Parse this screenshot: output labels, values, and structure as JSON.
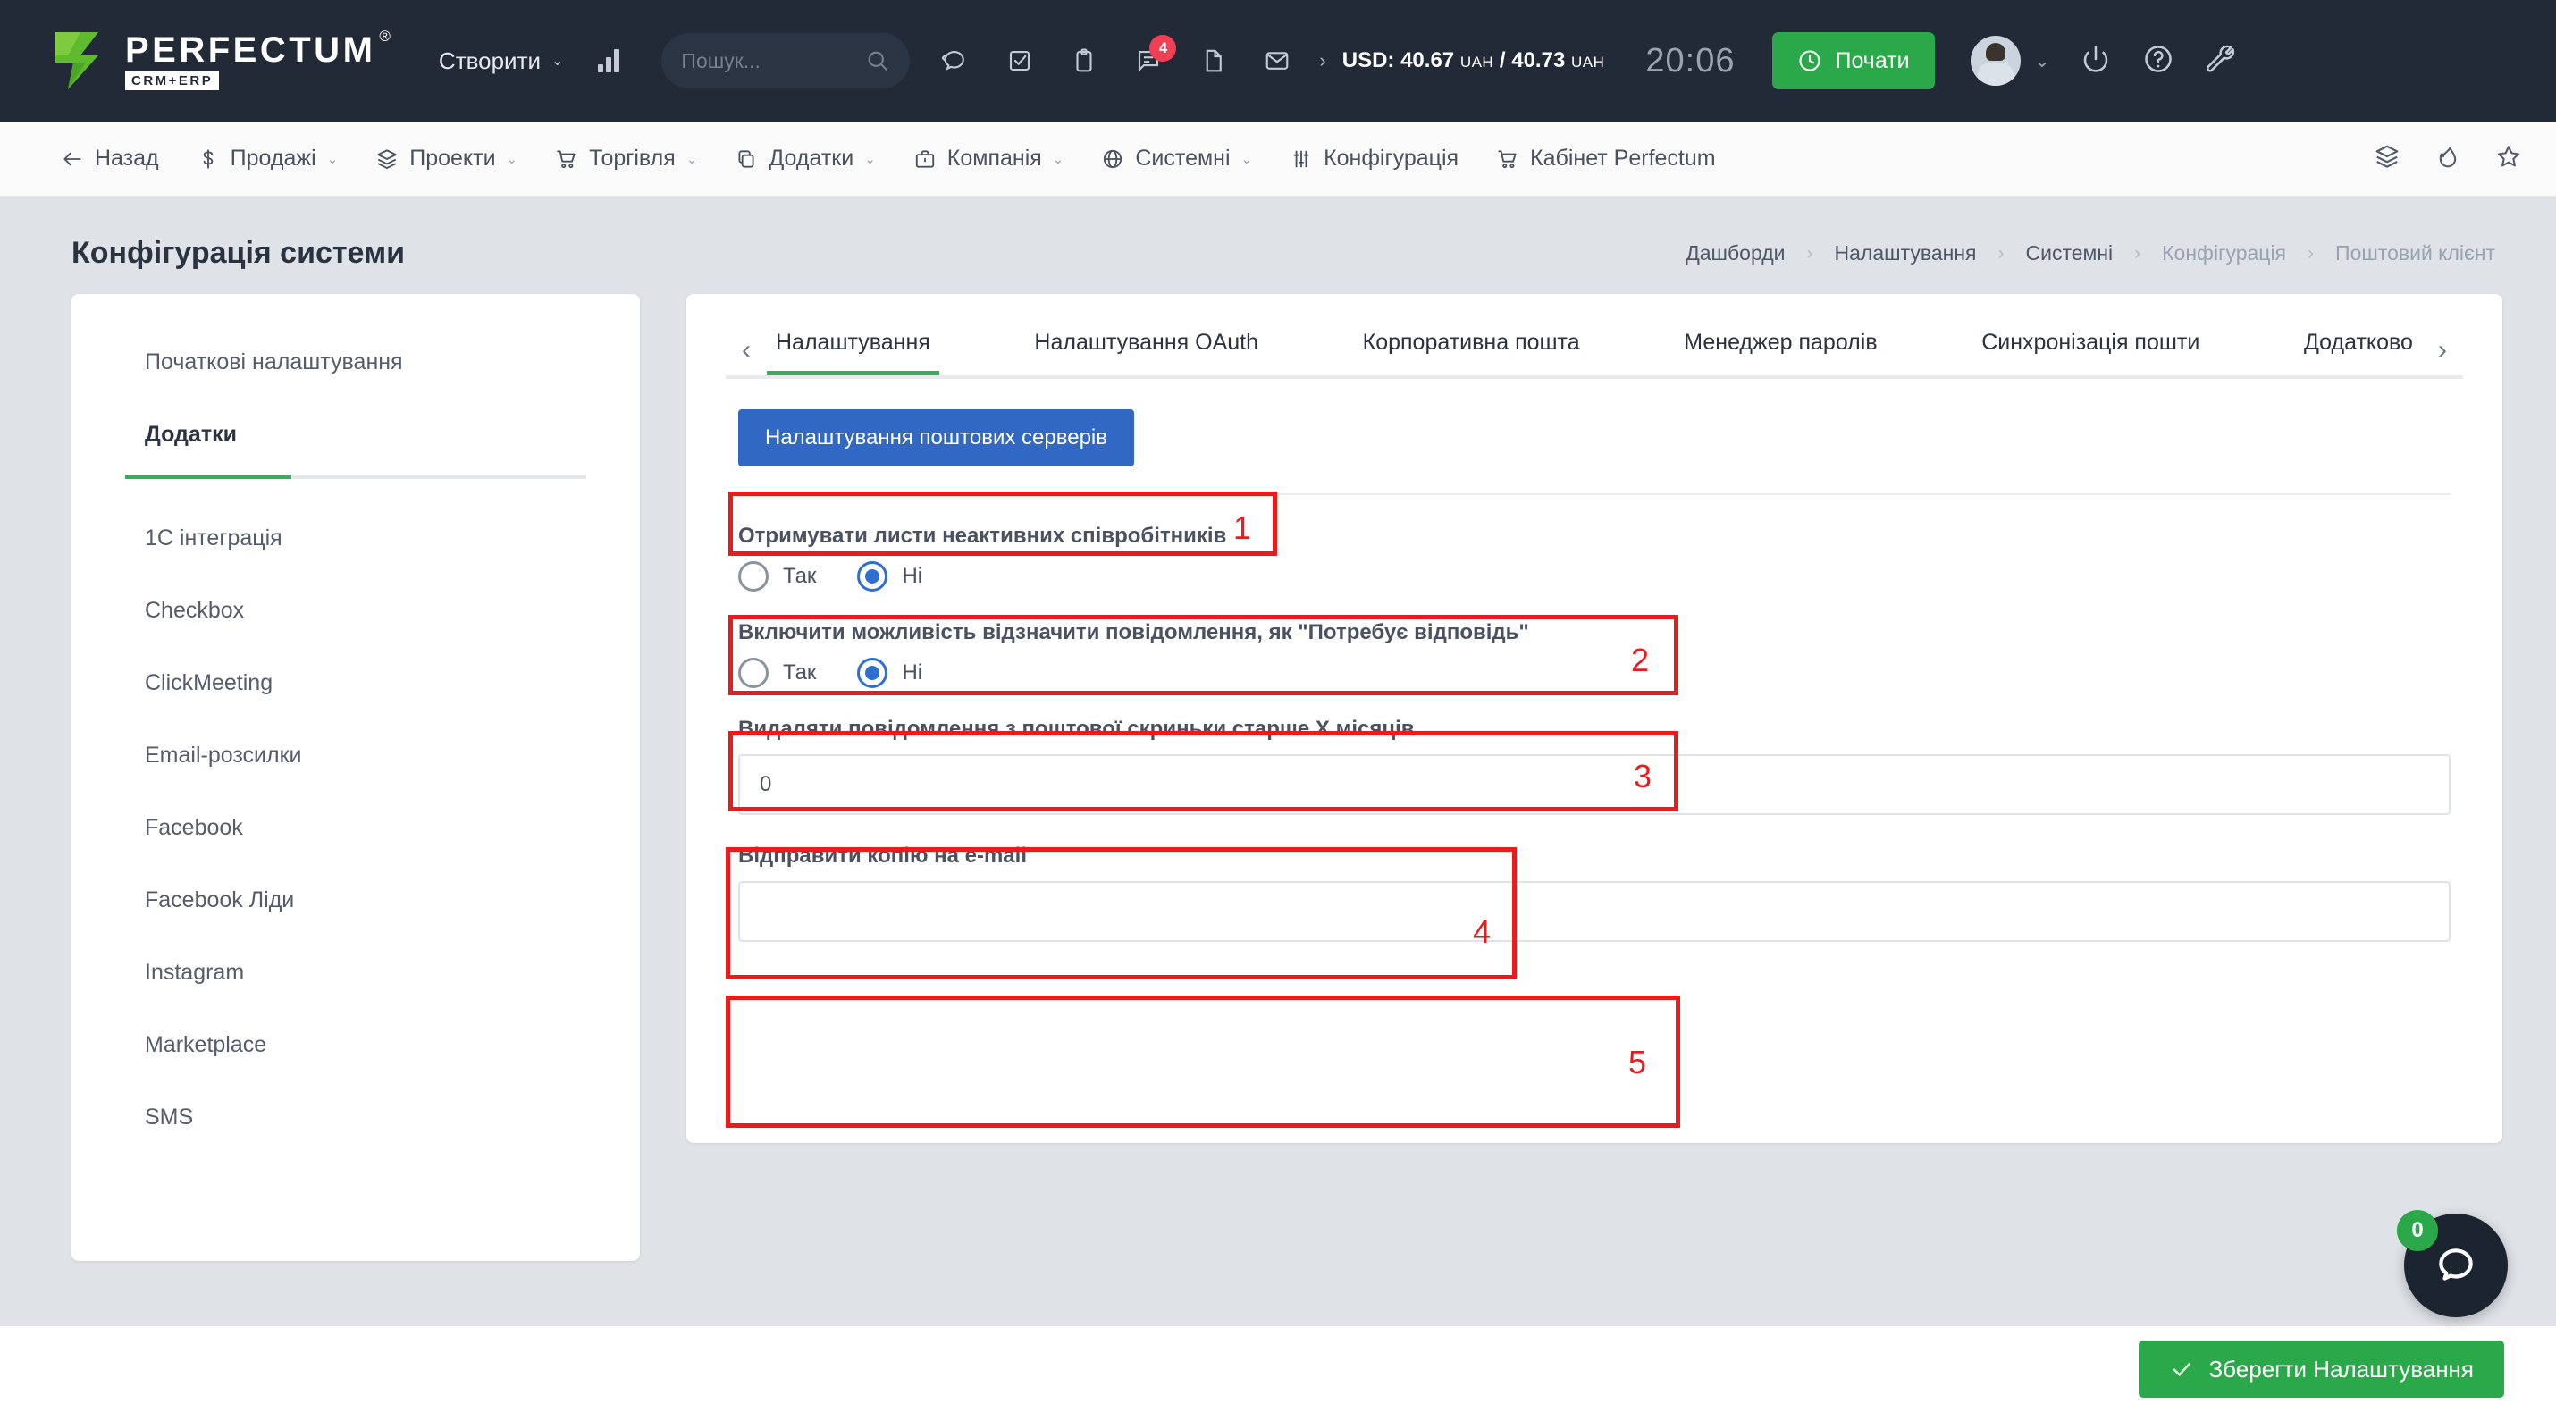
{
  "topbar": {
    "logo_main": "PERFECTUM",
    "logo_reg": "®",
    "logo_sub": "CRM+ERP",
    "create_label": "Створити",
    "search_placeholder": "Пошук...",
    "messages_badge": "4",
    "rate_label": "USD: 40.67",
    "rate_unit1": "UAH",
    "rate_sep": "/ 40.73",
    "rate_unit2": "UAH",
    "clock": "20:06",
    "start_label": "Почати",
    "icons": [
      "chart-bars-icon",
      "search-icon",
      "chat-bubble-icon",
      "task-check-icon",
      "clipboard-icon",
      "comments-icon",
      "document-icon",
      "envelope-icon",
      "avatar",
      "chevron-down-icon",
      "power-icon",
      "help-icon",
      "wrench-icon"
    ]
  },
  "navbar": {
    "back_label": "Назад",
    "items": [
      {
        "label": "Продажі",
        "icon": "dollar-icon",
        "has_caret": true
      },
      {
        "label": "Проекти",
        "icon": "layers-icon",
        "has_caret": true
      },
      {
        "label": "Торгівля",
        "icon": "cart-icon",
        "has_caret": true
      },
      {
        "label": "Додатки",
        "icon": "copy-icon",
        "has_caret": true
      },
      {
        "label": "Компанія",
        "icon": "briefcase-icon",
        "has_caret": true
      },
      {
        "label": "Системні",
        "icon": "globe-icon",
        "has_caret": true
      },
      {
        "label": "Конфігурація",
        "icon": "sliders-icon",
        "has_caret": false
      },
      {
        "label": "Кабінет Perfectum",
        "icon": "cart-icon",
        "has_caret": false
      }
    ],
    "right_icons": [
      "layers-icon",
      "fire-icon",
      "star-icon"
    ]
  },
  "page": {
    "title": "Конфігурація системи",
    "breadcrumbs": [
      {
        "label": "Дашборди",
        "dim": false
      },
      {
        "label": "Налаштування",
        "dim": false
      },
      {
        "label": "Системні",
        "dim": false
      },
      {
        "label": "Конфігурація",
        "dim": true
      },
      {
        "label": "Поштовий клієнт",
        "dim": true
      }
    ]
  },
  "sidebar": {
    "header": "Початкові налаштування",
    "active": "Додатки",
    "items": [
      "1С інтеграція",
      "Checkbox",
      "ClickMeeting",
      "Email-розсилки",
      "Facebook",
      "Facebook Ліди",
      "Instagram",
      "Marketplace",
      "SMS"
    ]
  },
  "main": {
    "tabs": [
      {
        "label": "Налаштування",
        "active": true
      },
      {
        "label": "Налаштування OAuth",
        "active": false
      },
      {
        "label": "Корпоративна пошта",
        "active": false
      },
      {
        "label": "Менеджер паролів",
        "active": false
      },
      {
        "label": "Синхронізація пошти",
        "active": false
      },
      {
        "label": "Додатково",
        "active": false
      }
    ],
    "tab_prev_icon": "chevron-left-icon",
    "tab_next_icon": "chevron-right-icon",
    "mail_servers_button": "Налаштування поштових серверів",
    "fields": {
      "inactive_mail": {
        "label": "Отримувати листи неактивних співробітників",
        "yes": "Так",
        "no": "Ні",
        "selected": "no"
      },
      "needs_reply": {
        "label": "Включити можливість відзначити повідомлення, як \"Потребує відповідь\"",
        "yes": "Так",
        "no": "Ні",
        "selected": "no"
      },
      "delete_older": {
        "label": "Видаляти повідомлення з поштової скриньки старше X місяців",
        "value": "0",
        "placeholder": ""
      },
      "copy_email": {
        "label": "Відправити копію на e-mail",
        "value": "",
        "placeholder": ""
      }
    }
  },
  "annotations": {
    "numbers": [
      "1",
      "2",
      "3",
      "4",
      "5"
    ],
    "color": "#e81c1c"
  },
  "footer": {
    "save_label": "Зберегти Налаштування",
    "save_icon": "check-icon",
    "chat_badge": "0",
    "chat_icon": "chat-bubble-icon"
  }
}
